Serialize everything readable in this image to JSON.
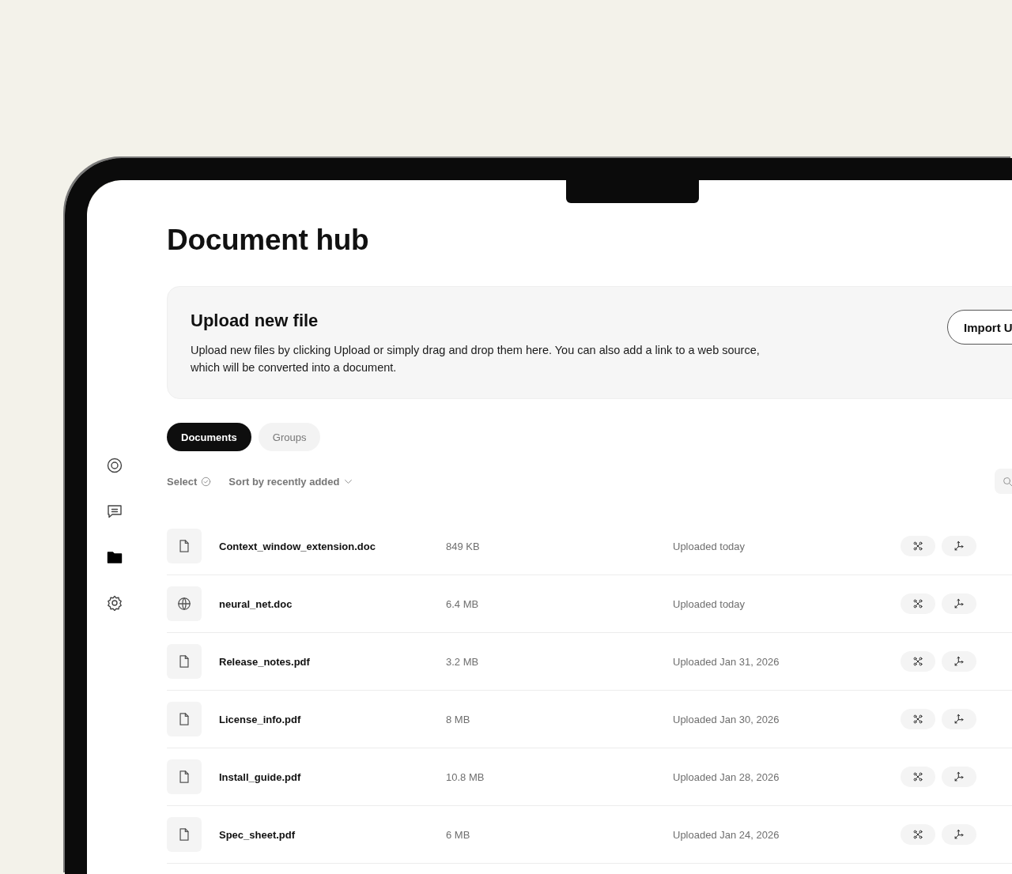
{
  "sidebar": {
    "items": [
      {
        "selected": false
      },
      {
        "selected": false
      },
      {
        "selected": true
      },
      {
        "selected": false
      }
    ]
  },
  "page": {
    "title": "Document hub"
  },
  "upload": {
    "title": "Upload new file",
    "description": "Upload new files by clicking Upload or simply drag and drop them here. You can also add a link to a web source, which will be converted into a document.",
    "button": "Import U"
  },
  "tabs": [
    {
      "label": "Documents",
      "selected": true
    },
    {
      "label": "Groups",
      "selected": false
    }
  ],
  "toolbar": {
    "select": "Select",
    "sort": "Sort by recently added"
  },
  "files": [
    {
      "kind": "file",
      "name": "Context_window_extension.doc",
      "size": "849 KB",
      "uploaded": "Uploaded today"
    },
    {
      "kind": "web",
      "name": "neural_net.doc",
      "size": "6.4 MB",
      "uploaded": "Uploaded today"
    },
    {
      "kind": "file",
      "name": "Release_notes.pdf",
      "size": "3.2 MB",
      "uploaded": "Uploaded Jan 31, 2026"
    },
    {
      "kind": "file",
      "name": "License_info.pdf",
      "size": "8 MB",
      "uploaded": "Uploaded Jan 30, 2026"
    },
    {
      "kind": "file",
      "name": "Install_guide.pdf",
      "size": "10.8 MB",
      "uploaded": "Uploaded Jan 28, 2026"
    },
    {
      "kind": "file",
      "name": "Spec_sheet.pdf",
      "size": "6 MB",
      "uploaded": "Uploaded Jan 24, 2026"
    }
  ]
}
